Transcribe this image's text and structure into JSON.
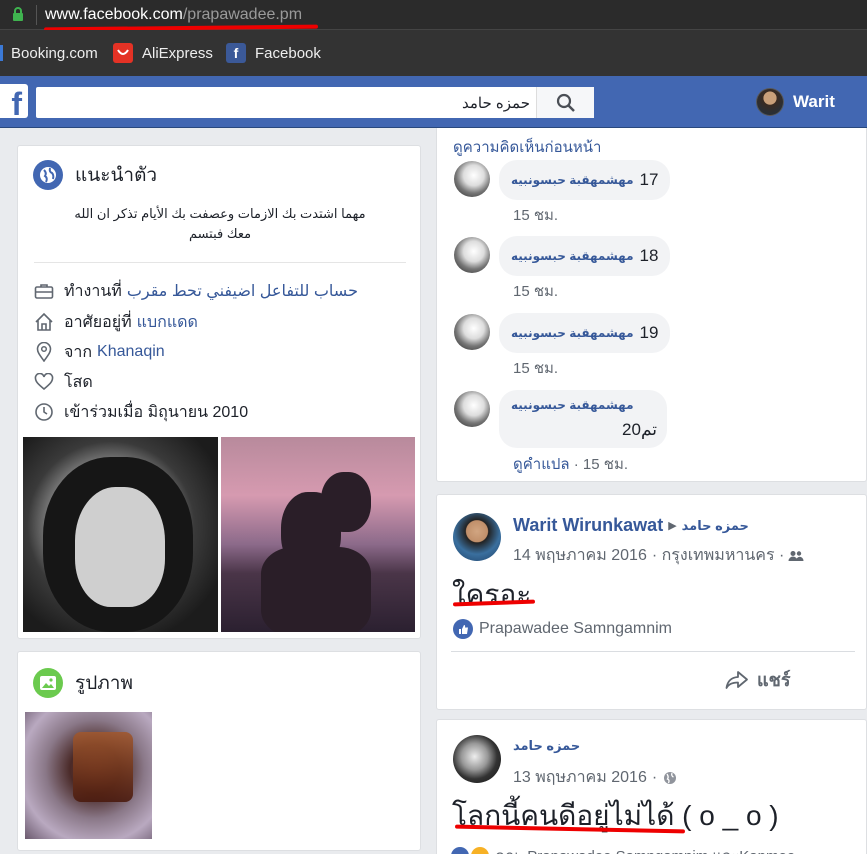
{
  "browser": {
    "url_domain": "www.facebook.com",
    "url_path": "/prapawadee.pm",
    "bookmarks": [
      {
        "label": "Booking.com",
        "color": "#003580"
      },
      {
        "label": "AliExpress",
        "color": "#e43225"
      },
      {
        "label": "Facebook",
        "color": "#3b5998"
      }
    ]
  },
  "topbar": {
    "logo": "f",
    "search_value": "حمزه حامد",
    "user_name": "Warit"
  },
  "intro": {
    "title": "แนะนำตัว",
    "bio_line1": "مهما اشتدت بك الازمات وعصفت بك الأيام تذكر ان الله",
    "bio_line2": "معك فبتسم",
    "work_prefix": "ทำงานที่",
    "work_value": "حساب للتفاعل اضيفني تحط مقرب",
    "lives_prefix": "อาศัยอยู่ที่",
    "lives_value": "แบกแดด",
    "from_prefix": "จาก",
    "from_value": "Khanaqin",
    "relationship": "โสด",
    "joined": "เข้าร่วมเมื่อ มิถุนายน 2010"
  },
  "photos": {
    "title": "รูปภาพ"
  },
  "comments": {
    "see_previous": "ดูความคิดเห็นก่อนหน้า",
    "items": [
      {
        "name": "ﻣﻬﺸﻤﻬﻘﺒﺔ ﺣﺒﺴﻮﻧﺒﻴﻪ",
        "text": "17",
        "time": "15 ชม."
      },
      {
        "name": "ﻣﻬﺸﻤﻬﻘﺒﺔ ﺣﺒﺴﻮﻧﺒﻴﻪ",
        "text": "18",
        "time": "15 ชม."
      },
      {
        "name": "ﻣﻬﺸﻤﻬﻘﺒﺔ ﺣﺒﺴﻮﻧﺒﻴﻪ",
        "text": "19",
        "time": "15 ชม."
      }
    ],
    "last_name": "ﻣﻬﺸﻤﻬﻘﺒﺔ ﺣﺒﺴﻮﻧﺒﻴﻪ",
    "last_text": "20ﺗﻢ",
    "translate": "ดูคำแปล",
    "last_time": "· 15 ชม."
  },
  "post1": {
    "author": "Warit Wirunkawat",
    "target": "حمزه حامد",
    "date": "14 พฤษภาคม 2016",
    "location": "· กรุงเทพมหานคร ·",
    "text": "ใครอะ",
    "liker": "Prapawadee Samngamnim",
    "share": "แชร์"
  },
  "post2": {
    "author": "حمزه حامد",
    "date": "13 พฤษภาคม 2016",
    "dot": "·",
    "text": "โลกนี้คนดีอยู่ไม่ได้ ( o _ o )",
    "likers": "คุณ, Prapawadee Samngamnim และKapmee"
  }
}
